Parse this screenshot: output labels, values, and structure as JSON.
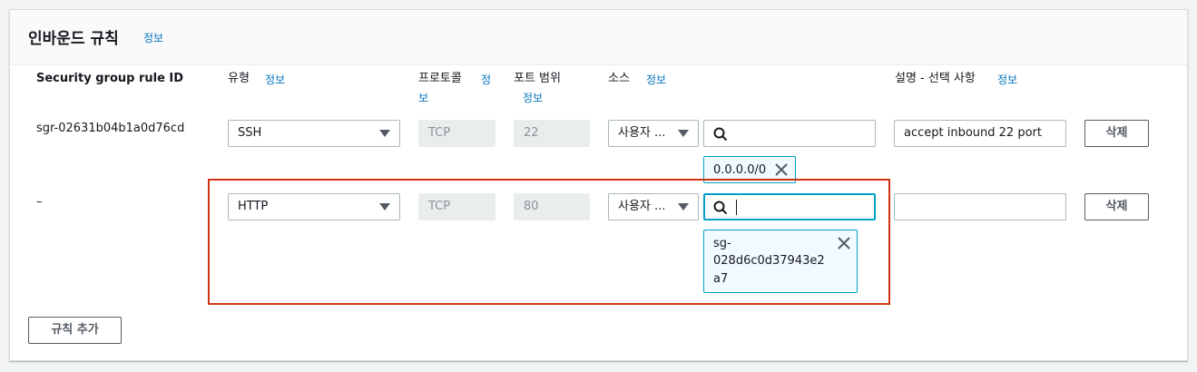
{
  "header": {
    "title": "인바운드 규칙",
    "info": "정보"
  },
  "columns": {
    "rule_id": "Security group rule ID",
    "type": "유형",
    "type_info": "정보",
    "protocol": "프로토콜",
    "protocol_info_1": "정",
    "protocol_info_2": "보",
    "port_range": "포트 범위",
    "port_info": "정보",
    "source": "소스",
    "source_info": "정보",
    "description": "설명 - 선택 사항",
    "description_info": "정보"
  },
  "rows": [
    {
      "rule_id": "sgr-02631b04b1a0d76cd",
      "type": "SSH",
      "protocol": "TCP",
      "port": "22",
      "source_type": "사용자 ...",
      "search_value": "",
      "token": "0.0.0.0/0",
      "description": "accept inbound 22 port",
      "delete_label": "삭제"
    },
    {
      "rule_id": "–",
      "type": "HTTP",
      "protocol": "TCP",
      "port": "80",
      "source_type": "사용자 ...",
      "search_value": "",
      "token_line1": "sg-",
      "token_line2": "028d6c0d37943e2",
      "token_line3": "a7",
      "description": "",
      "delete_label": "삭제"
    }
  ],
  "add_rule_label": "규칙 추가",
  "colors": {
    "link": "#0073bb",
    "focus": "#00a1c9",
    "highlight": "#d13212"
  }
}
